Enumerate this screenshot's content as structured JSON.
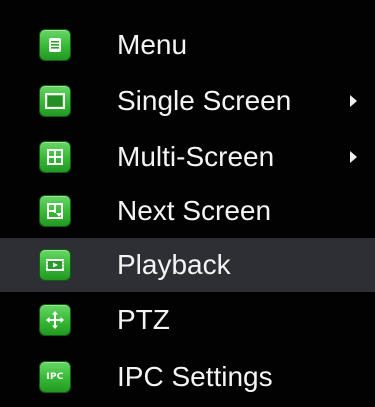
{
  "menu": {
    "items": [
      {
        "label": "Menu",
        "icon": "menu-icon",
        "has_submenu": false,
        "selected": false
      },
      {
        "label": "Single Screen",
        "icon": "single-screen-icon",
        "has_submenu": true,
        "selected": false
      },
      {
        "label": "Multi-Screen",
        "icon": "multi-screen-icon",
        "has_submenu": true,
        "selected": false
      },
      {
        "label": "Next Screen",
        "icon": "next-screen-icon",
        "has_submenu": false,
        "selected": false
      },
      {
        "label": "Playback",
        "icon": "playback-icon",
        "has_submenu": false,
        "selected": true
      },
      {
        "label": "PTZ",
        "icon": "ptz-icon",
        "has_submenu": false,
        "selected": false
      },
      {
        "label": "IPC Settings",
        "icon": "ipc-settings-icon",
        "has_submenu": false,
        "selected": false
      }
    ],
    "icon_badge_text": "IPC"
  },
  "colors": {
    "background": "#020202",
    "selected_row": "#2d2f35",
    "icon_green": "#37b836",
    "text": "#f4f4f4"
  }
}
